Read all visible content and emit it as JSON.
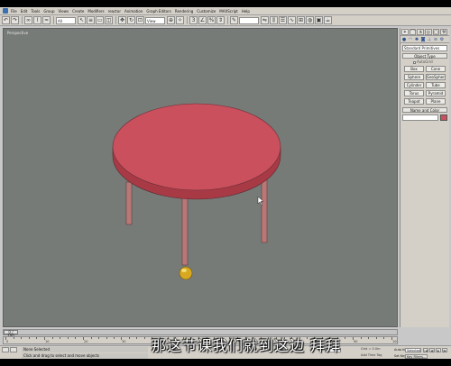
{
  "menubar": {
    "items": [
      "File",
      "Edit",
      "Tools",
      "Group",
      "Views",
      "Create",
      "Modifiers",
      "reactor",
      "Animation",
      "Graph Editors",
      "Rendering",
      "Customize",
      "MAXScript",
      "Help"
    ]
  },
  "toolbar": {
    "selection_filter": "All",
    "reference_coord": "View",
    "named_selection": "",
    "snaps_label": "3"
  },
  "viewport": {
    "label": "Perspective",
    "background": "#777b78",
    "tabletop_color": "#c9505c",
    "leg_color": "#b87877",
    "ball_color": "#e0b020"
  },
  "command_panel": {
    "tabs": [
      "create-tab",
      "modify-tab",
      "hierarchy-tab",
      "motion-tab",
      "display-tab",
      "utilities-tab"
    ],
    "category": "Standard Primitives",
    "object_type_header": "Object Type",
    "autogrid_label": "AutoGrid",
    "buttons": [
      "Box",
      "Cone",
      "Sphere",
      "GeoSphere",
      "Cylinder",
      "Tube",
      "Torus",
      "Pyramid",
      "Teapot",
      "Plane"
    ],
    "name_color_header": "Name and Color",
    "swatch_color": "#c9505c"
  },
  "timeline": {
    "thumb_label": "0 / 100",
    "ticks": [
      "0",
      "10",
      "20",
      "30",
      "40",
      "50",
      "60",
      "70",
      "80",
      "90",
      "100"
    ]
  },
  "statusbar": {
    "line1": "None Selected",
    "line2": "Click and drag to select and move objects",
    "grid_text": "Grid = 0.0m",
    "add_time_tag": "Add Time Tag",
    "auto_key": "Auto Key",
    "auto_key_value": "Selected",
    "set_key": "Set Key",
    "key_filters": "Key Filters..."
  },
  "subtitle": "那这节课我们就到这边 拜拜"
}
